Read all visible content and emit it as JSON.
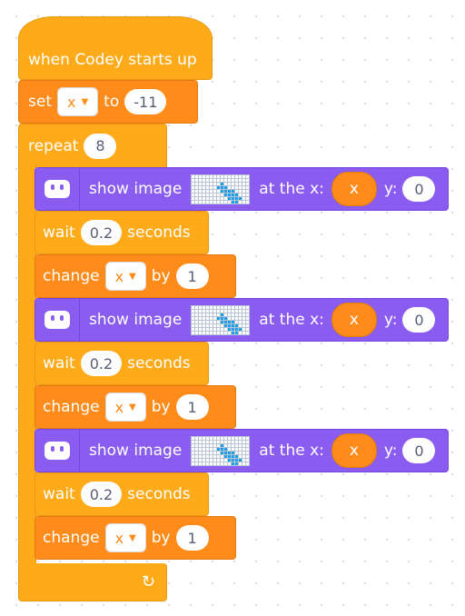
{
  "hat": {
    "label": "when Codey starts up"
  },
  "set_block": {
    "label": "set",
    "variable": "x",
    "to_label": "to",
    "value": "-11"
  },
  "repeat_block": {
    "label": "repeat",
    "count": "8",
    "loop_icon": "loop-arrow-icon"
  },
  "show_blocks": [
    {
      "label": "show image",
      "at_label": "at the x:",
      "x_var": "x",
      "y_label": "y:",
      "y_value": "0"
    },
    {
      "label": "show image",
      "at_label": "at the x:",
      "x_var": "x",
      "y_label": "y:",
      "y_value": "0"
    },
    {
      "label": "show image",
      "at_label": "at the x:",
      "x_var": "x",
      "y_label": "y:",
      "y_value": "0"
    }
  ],
  "wait_blocks": [
    {
      "label": "wait",
      "value": "0.2",
      "unit": "seconds"
    },
    {
      "label": "wait",
      "value": "0.2",
      "unit": "seconds"
    },
    {
      "label": "wait",
      "value": "0.2",
      "unit": "seconds"
    }
  ],
  "change_blocks": [
    {
      "label": "change",
      "variable": "x",
      "by_label": "by",
      "value": "1"
    },
    {
      "label": "change",
      "variable": "x",
      "by_label": "by",
      "value": "1"
    },
    {
      "label": "change",
      "variable": "x",
      "by_label": "by",
      "value": "1"
    }
  ],
  "colors": {
    "events": "#ffab19",
    "variables": "#ff8c1a",
    "display": "#8b5cf0",
    "pixel_on": "#1fa0e6"
  },
  "icons": {
    "category": "codey-robot-icon",
    "image": "pixel-image-icon"
  }
}
